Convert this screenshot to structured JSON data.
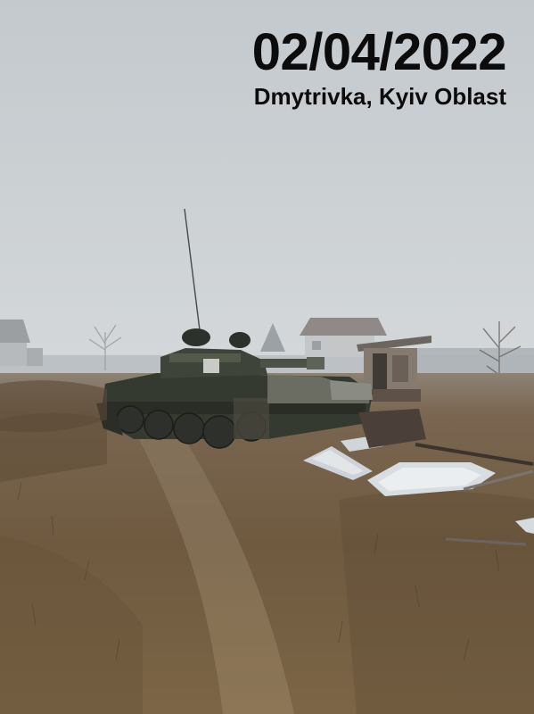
{
  "photo": {
    "overlay_date": "02/04/2022",
    "overlay_location": "Dmytrivka, Kyiv Oblast",
    "subjects": [
      "tank-icon",
      "house-icon",
      "shed-icon",
      "tree-icon",
      "debris-icon"
    ],
    "colors": {
      "sky_top": "#c5cbcf",
      "sky_bottom": "#d2d6d8",
      "grass_dark": "#5e4c35",
      "grass_light": "#8a7456",
      "tank_body": "#3a3f35",
      "overlay_text": "#0c0c0c"
    }
  }
}
